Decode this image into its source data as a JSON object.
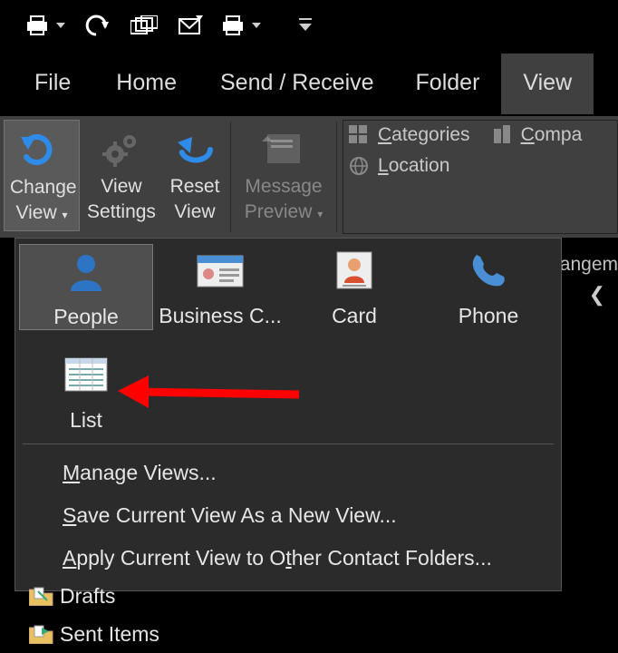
{
  "qat": {
    "items": [
      "print-dropdown",
      "undo",
      "windows",
      "send-receive",
      "archive-dropdown",
      "customize"
    ]
  },
  "tabs": {
    "file": "File",
    "home": "Home",
    "send_receive": "Send / Receive",
    "folder": "Folder",
    "view": "View"
  },
  "ribbon": {
    "change_view_line1": "Change",
    "change_view_line2": "View",
    "view_settings_line1": "View",
    "view_settings_line2": "Settings",
    "reset_view_line1": "Reset",
    "reset_view_line2": "View",
    "message_preview_line1": "Message",
    "message_preview_line2": "Preview",
    "categories": "Categories",
    "company": "Compa",
    "location": "Location",
    "arrangement_cut": "rangem"
  },
  "gallery": {
    "people": "People",
    "business_c": "Business C...",
    "card": "Card",
    "phone": "Phone",
    "list": "List",
    "manage_views": "Manage Views...",
    "save_view": "Save Current View As a New View...",
    "apply_view": "Apply Current View to Other Contact Folders..."
  },
  "nav": {
    "drafts": "Drafts",
    "sent_items": "Sent Items"
  }
}
